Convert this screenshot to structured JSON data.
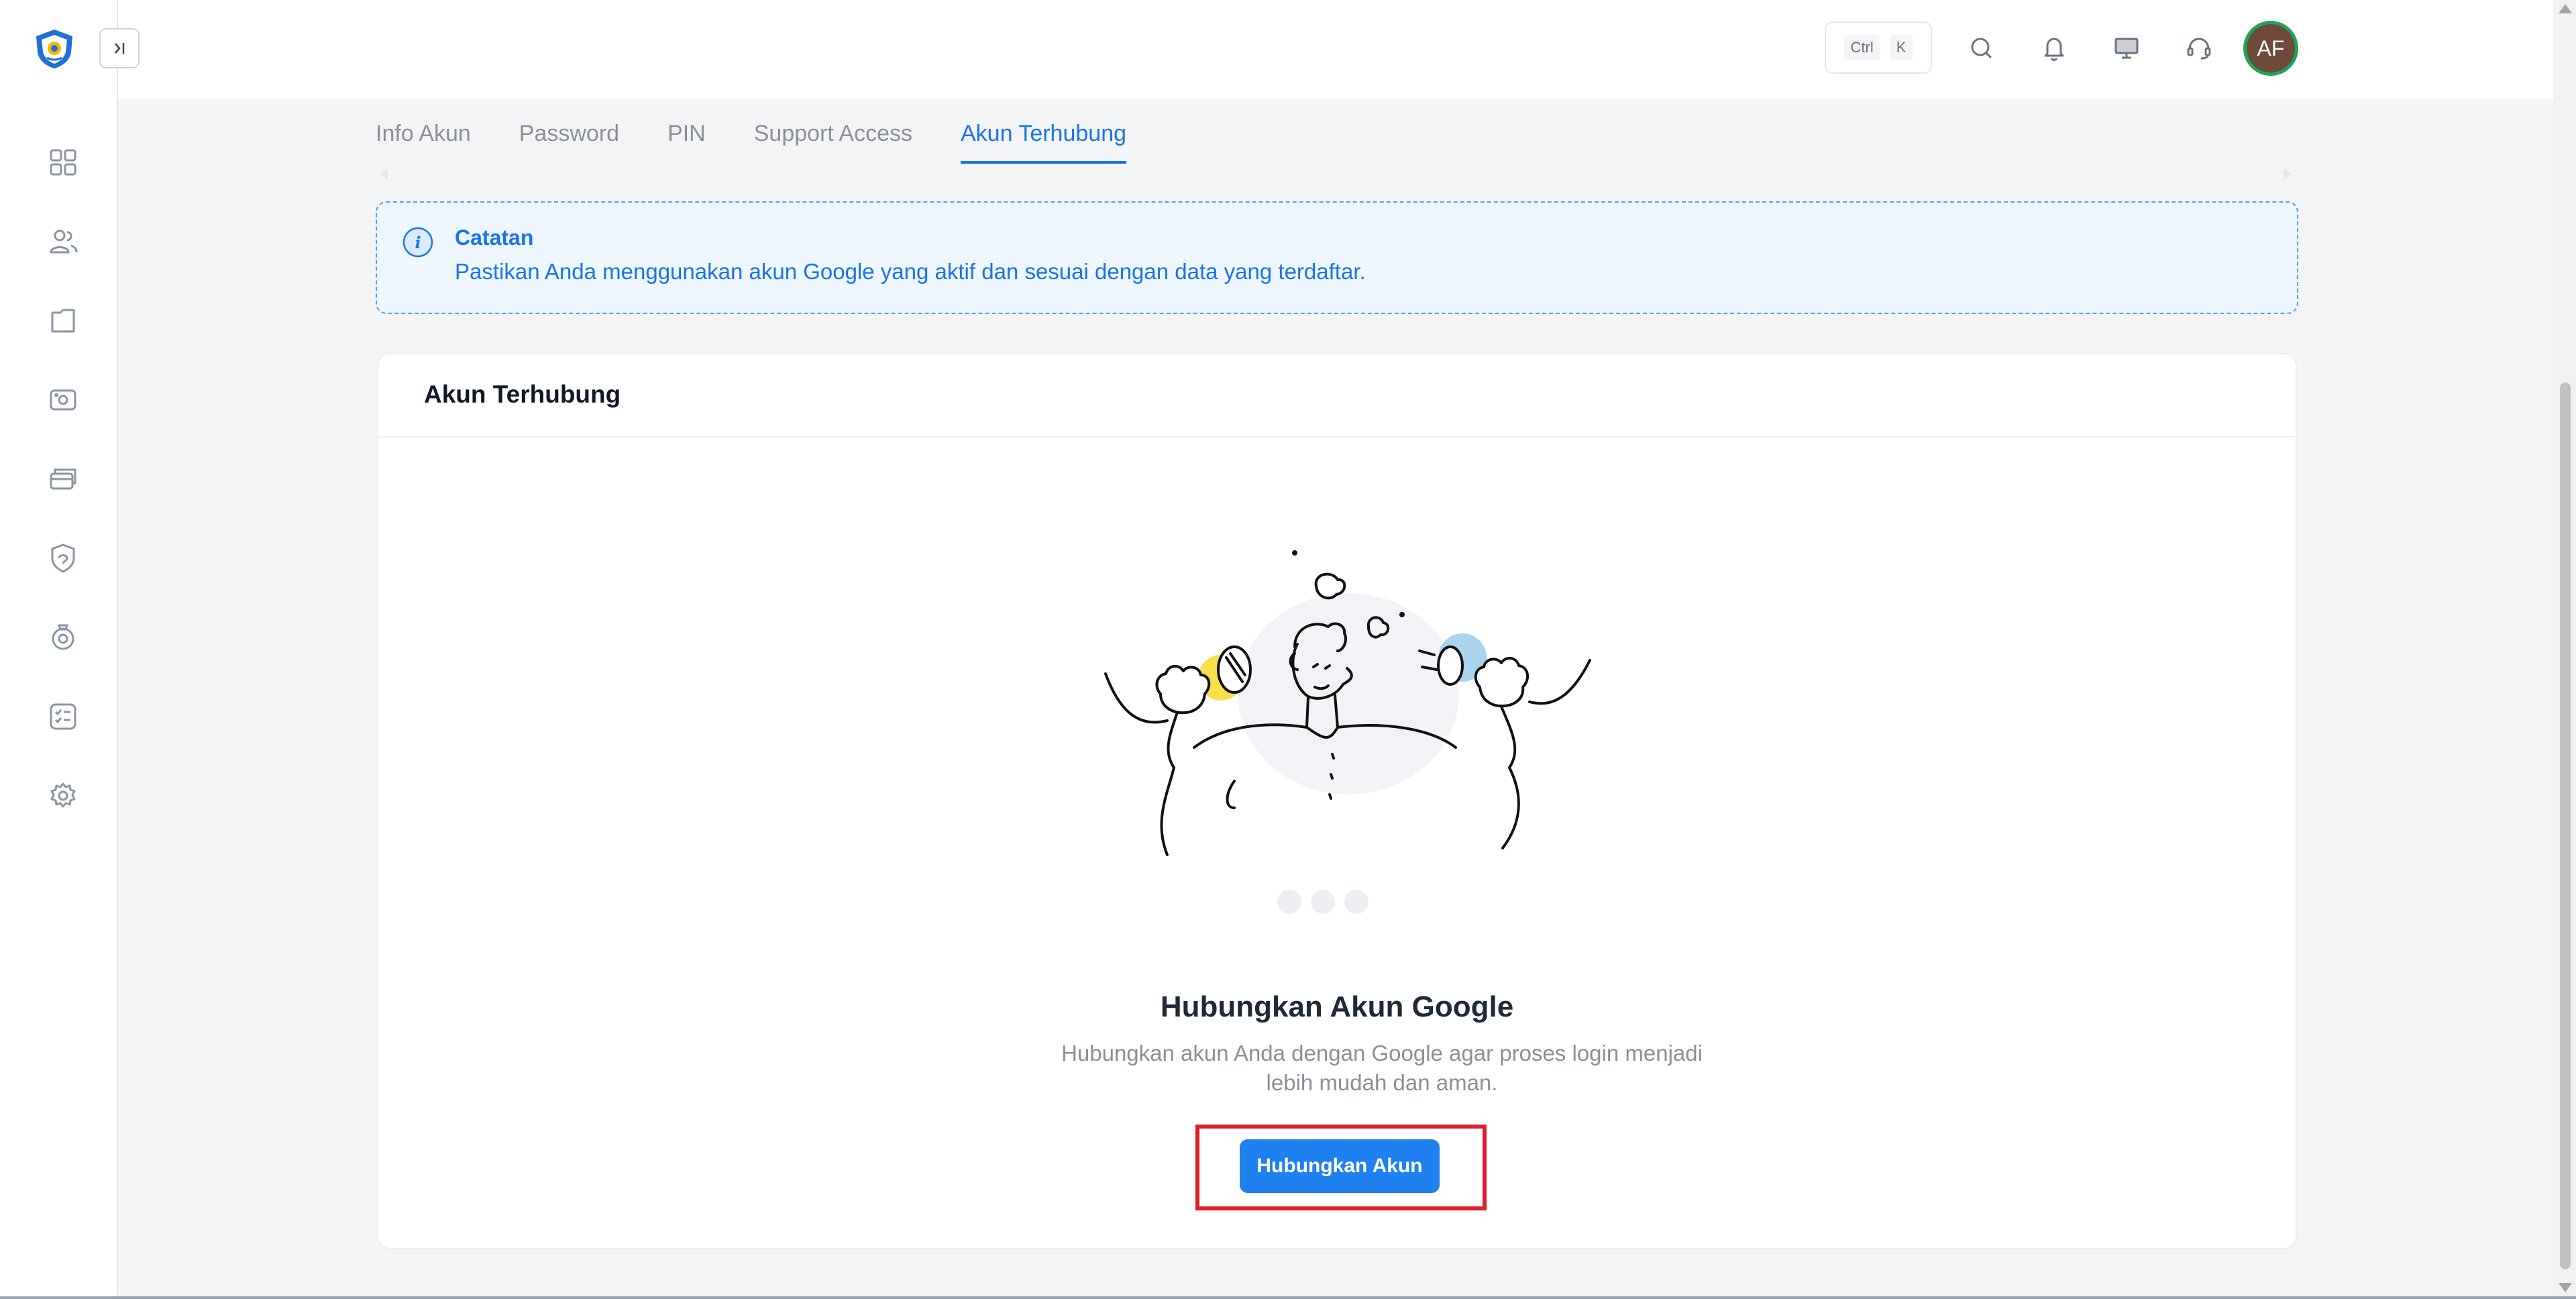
{
  "header": {
    "shortcut_keys": [
      "Ctrl",
      "K"
    ],
    "icons": [
      "search-icon",
      "bell-icon",
      "monitor-icon",
      "headset-icon"
    ],
    "avatar_initials": "AF",
    "avatar_color": "#6d4a3a",
    "avatar_ring_color": "#22a35a"
  },
  "sidebar": {
    "icons": [
      "dashboard-icon",
      "users-icon",
      "folder-icon",
      "camera-icon",
      "card-icon",
      "shield-icon",
      "badge-icon",
      "checklist-icon",
      "gear-icon"
    ]
  },
  "tabs": [
    {
      "label": "Info Akun",
      "active": false
    },
    {
      "label": "Password",
      "active": false
    },
    {
      "label": "PIN",
      "active": false
    },
    {
      "label": "Support Access",
      "active": false
    },
    {
      "label": "Akun Terhubung",
      "active": true
    }
  ],
  "note": {
    "title": "Catatan",
    "text": "Pastikan Anda menggunakan akun Google yang aktif dan sesuai dengan data yang terdaftar."
  },
  "card": {
    "title": "Akun Terhubung",
    "connect_title": "Hubungkan Akun Google",
    "connect_desc": "Hubungkan akun Anda dengan Google agar proses login menjadi lebih mudah dan aman.",
    "button_label": "Hubungkan Akun"
  },
  "colors": {
    "accent": "#1a73e8",
    "button": "#1f80ef",
    "highlight": "#e11d2a"
  }
}
